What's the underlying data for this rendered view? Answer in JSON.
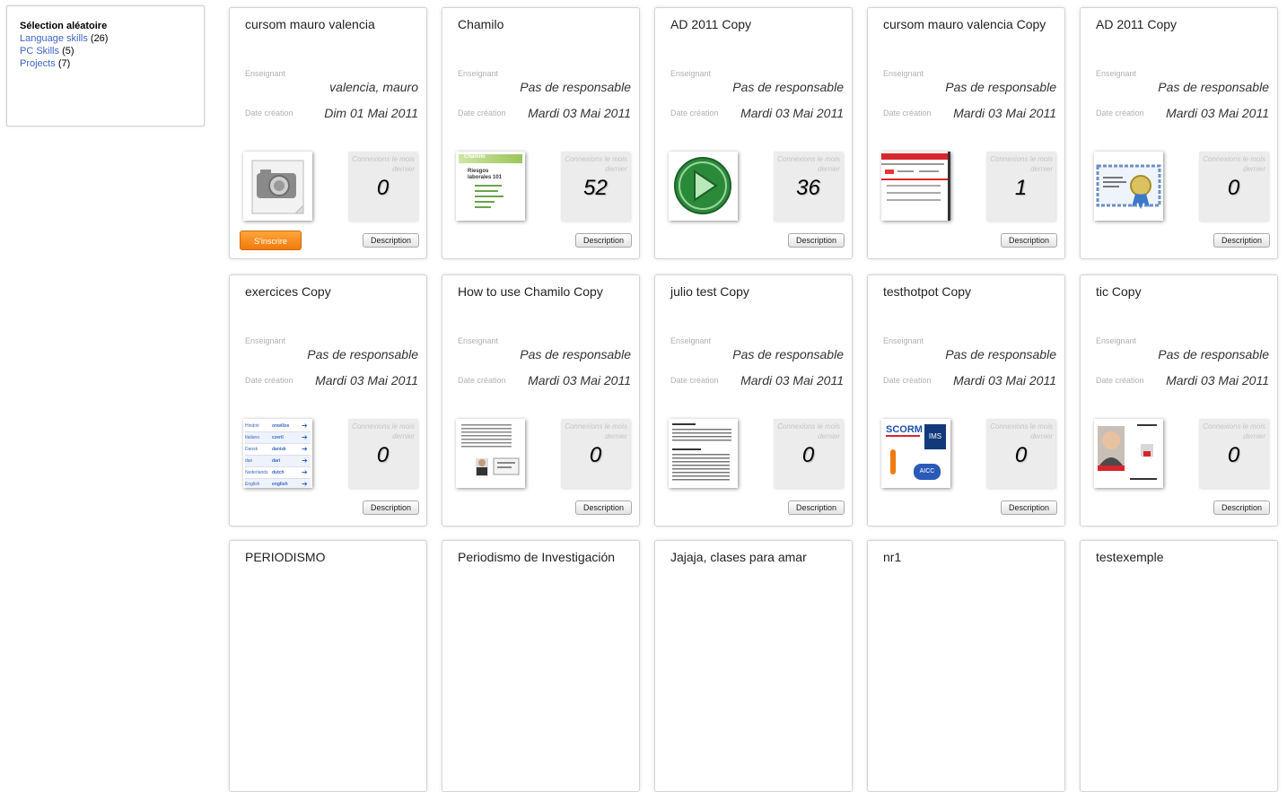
{
  "sidebar": {
    "title": "Sélection aléatoire",
    "categories": [
      {
        "label": "Language skills",
        "count": "(26)"
      },
      {
        "label": "PC Skills",
        "count": "(5)"
      },
      {
        "label": "Projects",
        "count": "(7)"
      }
    ]
  },
  "labels": {
    "teacher": "Enseignant",
    "date": "Date création",
    "connections": "Connexions le mois dernier",
    "description": "Description",
    "subscribe": "S'inscrire"
  },
  "courses": [
    {
      "title": "cursom mauro valencia",
      "teacher": "valencia, mauro",
      "date": "Dim 01 Mai 2011",
      "connections": "0",
      "thumb": "camera-placeholder-icon"
    },
    {
      "title": "Chamilo",
      "teacher": "Pas de responsable",
      "date": "Mardi 03 Mai 2011",
      "connections": "52",
      "thumb": "chamilo-document-thumbnail",
      "thumb_text": {
        "brand": "Chamilo",
        "heading": "Riesgos laborales 101"
      }
    },
    {
      "title": "AD 2011 Copy",
      "teacher": "Pas de responsable",
      "date": "Mardi 03 Mai 2011",
      "connections": "36",
      "thumb": "green-play-icon"
    },
    {
      "title": "cursom mauro valencia Copy",
      "teacher": "Pas de responsable",
      "date": "Mardi 03 Mai 2011",
      "connections": "1",
      "thumb": "web-page-thumbnail"
    },
    {
      "title": "AD 2011 Copy",
      "teacher": "Pas de responsable",
      "date": "Mardi 03 Mai 2011",
      "connections": "0",
      "thumb": "certificate-thumbnail"
    },
    {
      "title": "exercices Copy",
      "teacher": "Pas de responsable",
      "date": "Mardi 03 Mai 2011",
      "connections": "0",
      "thumb": "vocabulary-table-thumbnail",
      "thumb_text": {
        "rows": [
          [
            "Hindoti",
            "onwilize"
          ],
          [
            "Italiano",
            "czeril"
          ],
          [
            "Dansk",
            "danisk"
          ],
          [
            "dan",
            "dari"
          ],
          [
            "Nederlands",
            "dutch"
          ],
          [
            "English",
            "english"
          ]
        ]
      }
    },
    {
      "title": "How to use Chamilo Copy",
      "teacher": "Pas de responsable",
      "date": "Mardi 03 Mai 2011",
      "connections": "0",
      "thumb": "document-page-thumbnail"
    },
    {
      "title": "julio test Copy",
      "teacher": "Pas de responsable",
      "date": "Mardi 03 Mai 2011",
      "connections": "0",
      "thumb": "text-page-thumbnail"
    },
    {
      "title": "testhotpot Copy",
      "teacher": "Pas de responsable",
      "date": "Mardi 03 Mai 2011",
      "connections": "0",
      "thumb": "scorm-logos-thumbnail",
      "thumb_text": {
        "scorm": "SCORM",
        "ims": "IMS",
        "aicc": "AICC"
      }
    },
    {
      "title": "tic Copy",
      "teacher": "Pas de responsable",
      "date": "Mardi 03 Mai 2011",
      "connections": "0",
      "thumb": "profile-page-thumbnail"
    },
    {
      "title": "PERIODISMO"
    },
    {
      "title": "Periodismo de Investigación"
    },
    {
      "title": "Jajaja, clases para amar"
    },
    {
      "title": "nr1"
    },
    {
      "title": "testexemple"
    }
  ]
}
